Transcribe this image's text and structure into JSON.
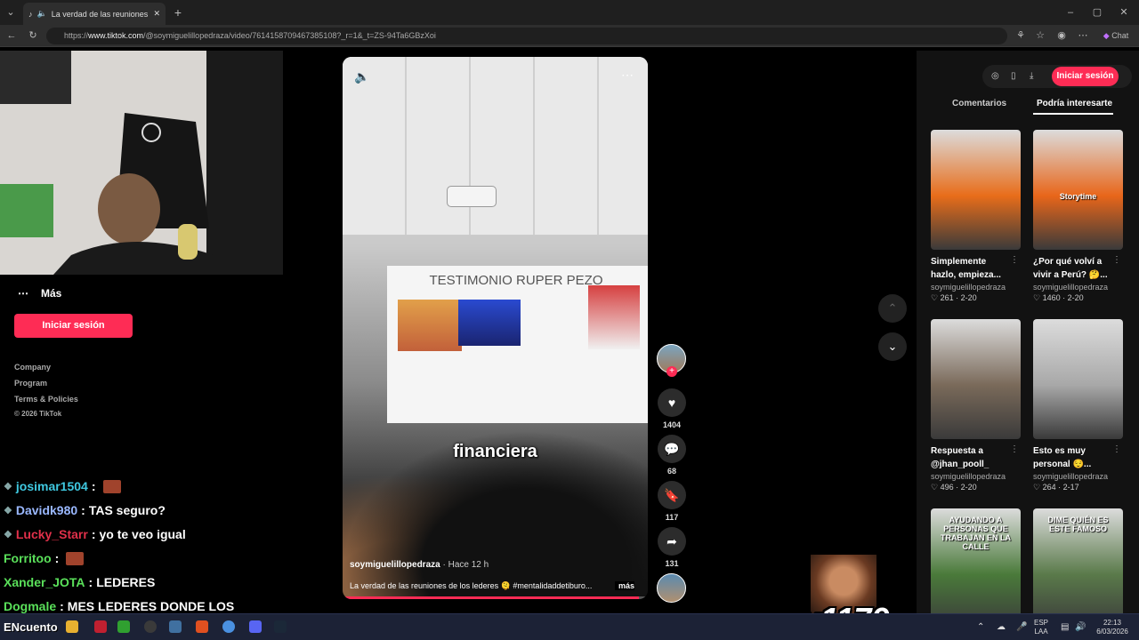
{
  "browser": {
    "tab_title": "La verdad de las reuniones de",
    "url_prefix": "https://",
    "url_domain": "www.tiktok.com",
    "url_rest": "/@soymiguelillopedraza/video/7614158709467385108?_r=1&_t=ZS-94Ta6GBzXoi",
    "chat_label": "Chat"
  },
  "sidebar": {
    "more_label": "Más",
    "login_label": "Iniciar sesión",
    "links": [
      "Company",
      "Program",
      "Terms & Policies"
    ],
    "copyright": "© 2026 TikTok"
  },
  "stream_chat": [
    {
      "user": "josimar1504",
      "sep": ":",
      "msg": "",
      "color": "#3fc8e0",
      "emote": true
    },
    {
      "user": "Davidk980",
      "sep": ":",
      "msg": "TAS seguro?",
      "color": "#9ab8ff",
      "emote": false
    },
    {
      "user": "Lucky_Starr",
      "sep": ":",
      "msg": "yo te veo igual",
      "color": "#e0304a",
      "emote": false
    },
    {
      "user": "Forritoo",
      "sep": ":",
      "msg": "",
      "color": "#5ae05a",
      "emote": true
    },
    {
      "user": "Xander_JOTA",
      "sep": ":",
      "msg": "LEDERES",
      "color": "#5ae05a",
      "emote": false
    },
    {
      "user": "Dogmale",
      "sep": ":",
      "msg": "MES LEDERES DONDE LOS",
      "color": "#5ae05a",
      "emote": false
    }
  ],
  "video": {
    "slide_title": "TESTIMONIO RUPER PEZO",
    "caption": "financiera",
    "author": "soymiguelillopedraza",
    "posted": "· Hace 12 h",
    "description": "La verdad de las reuniones de los lederes 🫠 #mentalidaddetiburo...",
    "more_label": "más",
    "progress": 0.97
  },
  "actions": {
    "likes": "1404",
    "comments": "68",
    "saves": "117",
    "shares": "131"
  },
  "overlay": {
    "multiplier": "x1179"
  },
  "right_panel": {
    "login_label": "Iniciar sesión",
    "tabs": [
      "Comentarios",
      "Podría interesarte"
    ],
    "cards": [
      {
        "title": "Simplemente hazlo, empieza...",
        "author": "soymiguelillopedraza",
        "likes": "261",
        "date": "2-20",
        "thumb_text": "",
        "color": "#e86d1a"
      },
      {
        "title": "¿Por qué volví a vivir a Perú? 🤔...",
        "author": "soymiguelillopedraza",
        "likes": "1460",
        "date": "2-20",
        "thumb_text": "Storytime",
        "color": "#e8661a"
      },
      {
        "title": "Respuesta a @jhan_pooll_ Toc...",
        "author": "soymiguelillopedraza",
        "likes": "496",
        "date": "2-20",
        "thumb_text": "",
        "color": "#7a6a5a"
      },
      {
        "title": "Esto es muy personal 😌...",
        "author": "soymiguelillopedraza",
        "likes": "264",
        "date": "2-17",
        "thumb_text": "",
        "color": "#a8a8a8"
      },
      {
        "title": "",
        "author": "",
        "likes": "",
        "date": "",
        "thumb_text": "AYUDANDO A PERSONAS QUE TRABAJAN EN LA CALLE",
        "color": "#4a7a3a"
      },
      {
        "title": "",
        "author": "",
        "likes": "",
        "date": "",
        "thumb_text": "DIME QUIÉN ES ESTE FAMOSO",
        "color": "#5a7a4a"
      }
    ]
  },
  "taskbar": {
    "streamer_label": "ENcuento",
    "lang": "ESP",
    "lang2": "LAA",
    "time": "22:13",
    "date": "6/03/2026"
  }
}
